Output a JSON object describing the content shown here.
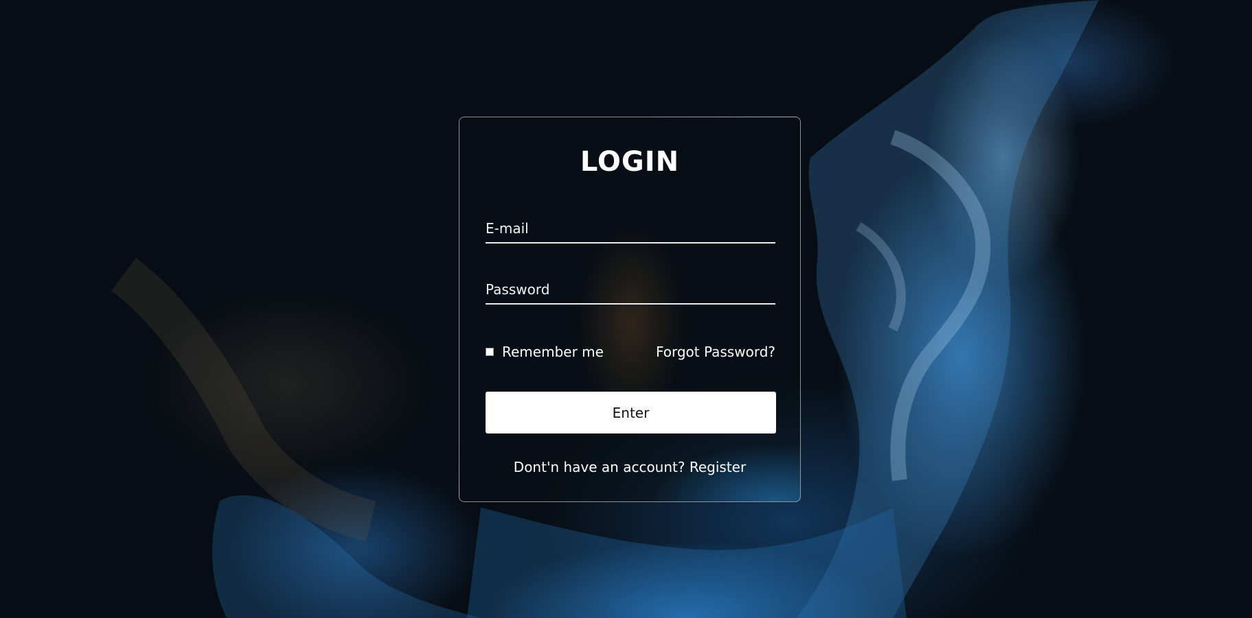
{
  "login": {
    "title": "LOGIN",
    "email_placeholder": "E-mail",
    "password_placeholder": "Password",
    "remember_label": "Remember me",
    "remember_checked": false,
    "forgot_label": "Forgot Password?",
    "enter_label": "Enter",
    "no_account_text": "Dont'n have an account?",
    "register_label": "Register"
  },
  "colors": {
    "background": "#070d14",
    "accent_blue": "#2f86c9",
    "text": "#ffffff",
    "button_bg": "#ffffff",
    "button_text": "#111111"
  }
}
